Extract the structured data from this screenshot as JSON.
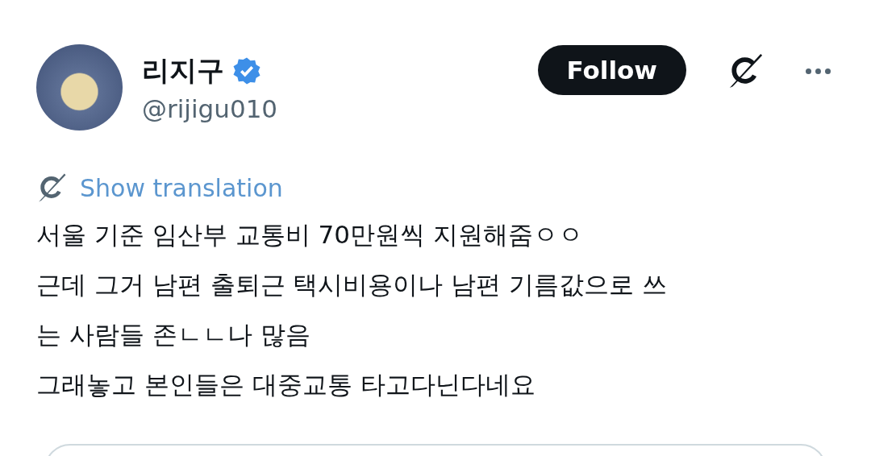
{
  "author": {
    "name": "리지구",
    "verified": true,
    "handle": "@rijigu010"
  },
  "follow_button": {
    "label": "Follow"
  },
  "translation_link": {
    "label": "Show translation"
  },
  "tweet_text": "서울 기준 임산부 교통비 70만원씩 지원해줌ㅇㅇ\n근데 그거 남편 출퇴근 택시비용이나 남편 기름값으로 쓰\n는 사람들 존ㄴㄴ나 많음\n그래놓고 본인들은 대중교통 타고다닌다네요"
}
